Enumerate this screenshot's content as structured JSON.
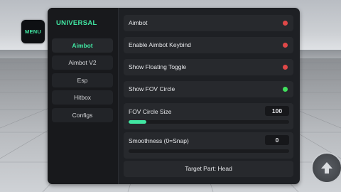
{
  "menu_button": {
    "label": "MENU"
  },
  "window": {
    "title": "UNIVERSAL",
    "accent_color": "#41e6a2"
  },
  "sidebar": {
    "items": [
      {
        "label": "Aimbot",
        "active": true
      },
      {
        "label": "Aimbot V2",
        "active": false
      },
      {
        "label": "Esp",
        "active": false
      },
      {
        "label": "Hitbox",
        "active": false
      },
      {
        "label": "Configs",
        "active": false
      }
    ]
  },
  "settings": {
    "toggles": [
      {
        "label": "Aimbot",
        "enabled": false
      },
      {
        "label": "Enable Aimbot Keybind",
        "enabled": false
      },
      {
        "label": "Show Floating Toggle",
        "enabled": false
      },
      {
        "label": "Show FOV Circle",
        "enabled": true
      }
    ],
    "sliders": [
      {
        "label": "FOV Circle Size",
        "value": "100",
        "fill_fraction": 0.11
      },
      {
        "label": "Smoothness (0=Snap)",
        "value": "0",
        "fill_fraction": 0
      }
    ],
    "target_part": {
      "label": "Target Part: Head"
    }
  },
  "status_colors": {
    "on": "#41e15d",
    "off": "#e04848"
  },
  "jump_button": {
    "icon": "arrow-up-icon"
  }
}
